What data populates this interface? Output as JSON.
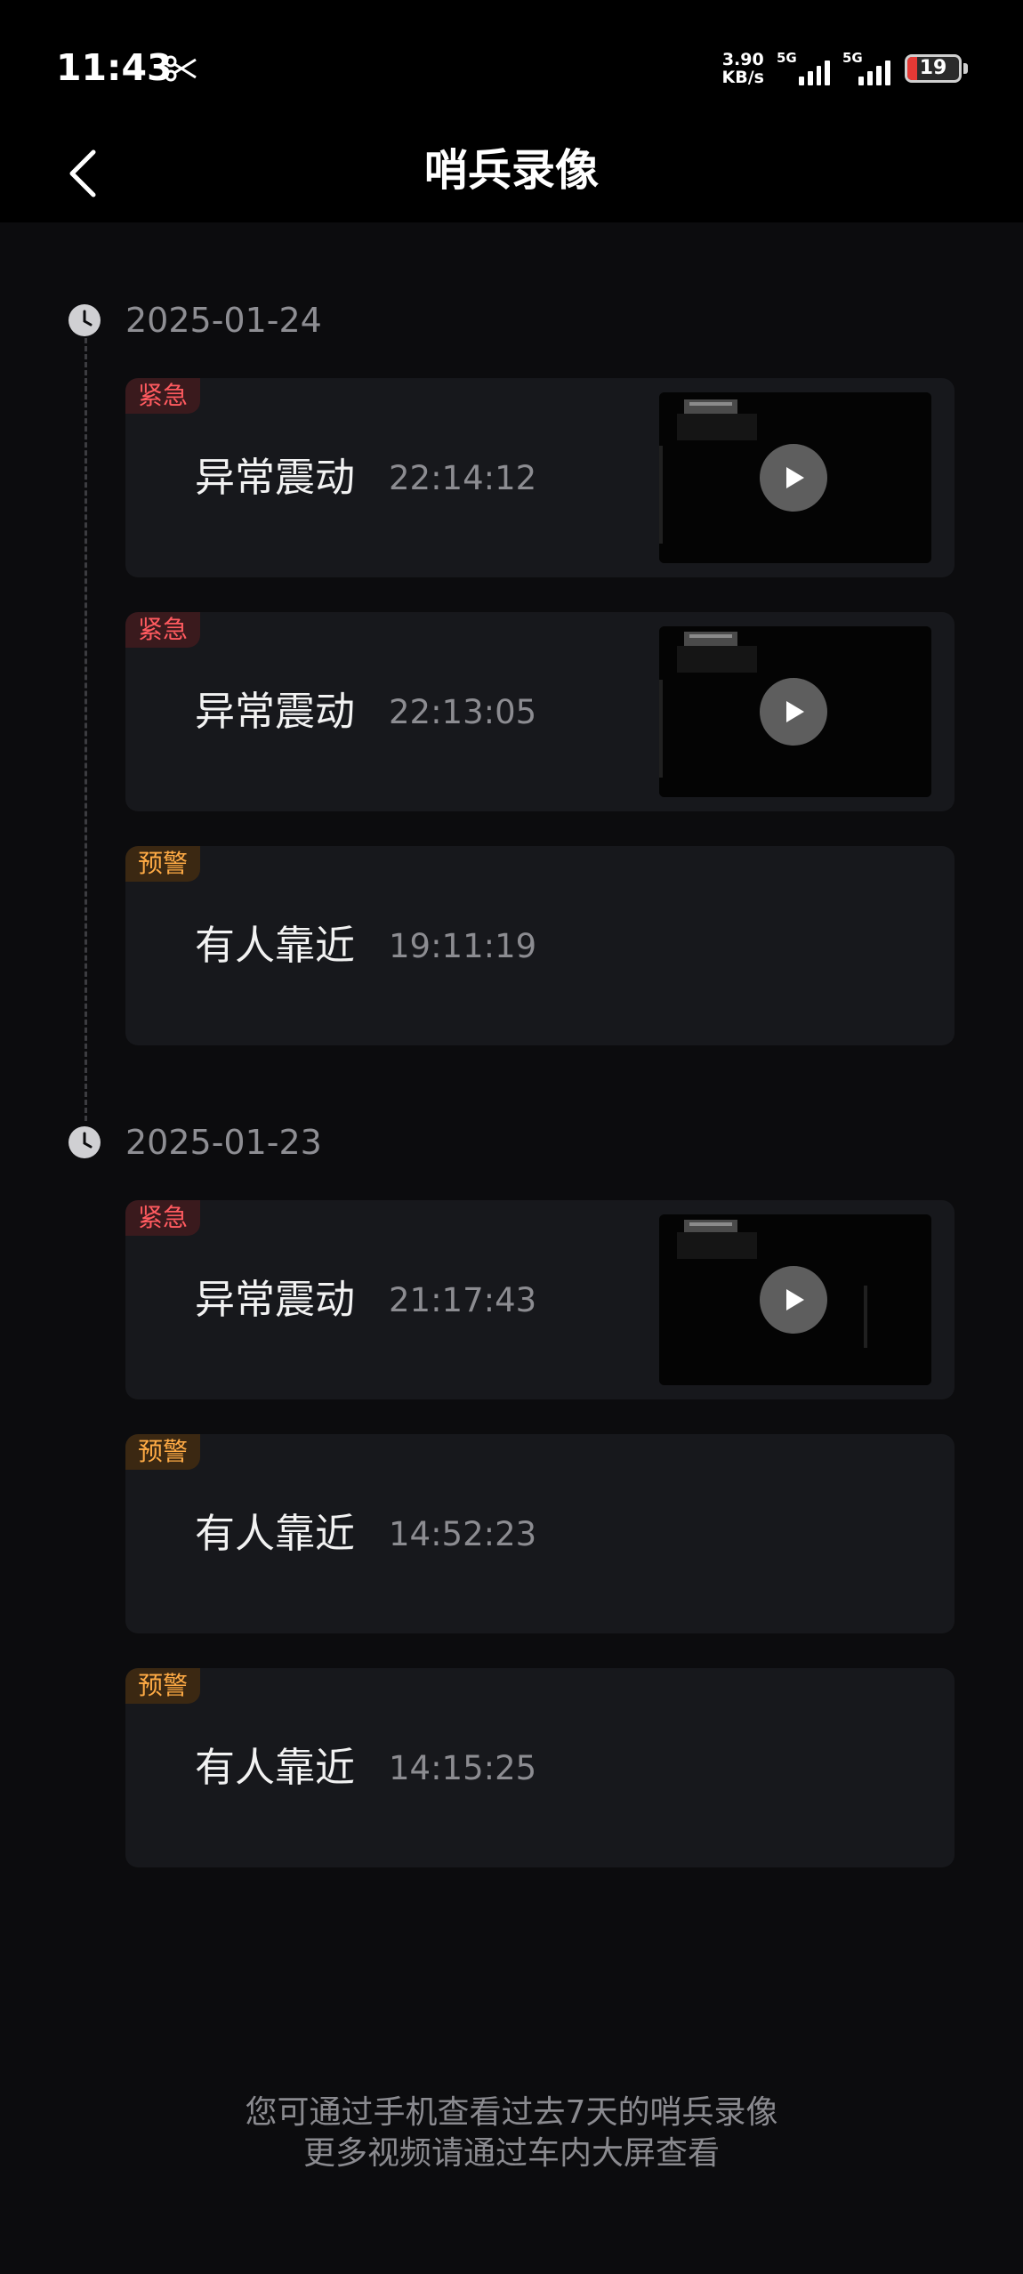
{
  "status_bar": {
    "time": "11:43",
    "net_speed_value": "3.90",
    "net_speed_unit": "KB/s",
    "signal1_label": "5G",
    "signal2_label": "5G",
    "battery_level": "19",
    "battery_color": "#e53935"
  },
  "header": {
    "title": "哨兵录像",
    "back_icon": "chevron-left-icon"
  },
  "groups": [
    {
      "date": "2025-01-24",
      "events": [
        {
          "tag": "紧急",
          "tag_type": "urgent",
          "name": "异常震动",
          "time": "22:14:12",
          "has_video": true
        },
        {
          "tag": "紧急",
          "tag_type": "urgent",
          "name": "异常震动",
          "time": "22:13:05",
          "has_video": true
        },
        {
          "tag": "预警",
          "tag_type": "warn",
          "name": "有人靠近",
          "time": "19:11:19",
          "has_video": false
        }
      ]
    },
    {
      "date": "2025-01-23",
      "events": [
        {
          "tag": "紧急",
          "tag_type": "urgent",
          "name": "异常震动",
          "time": "21:17:43",
          "has_video": true
        },
        {
          "tag": "预警",
          "tag_type": "warn",
          "name": "有人靠近",
          "time": "14:52:23",
          "has_video": false
        },
        {
          "tag": "预警",
          "tag_type": "warn",
          "name": "有人靠近",
          "time": "14:15:25",
          "has_video": false
        }
      ]
    }
  ],
  "footer": {
    "line1": "您可通过手机查看过去7天的哨兵录像",
    "line2": "更多视频请通过车内大屏查看"
  },
  "colors": {
    "urgent": "#ff5a5f",
    "warn": "#ffab45",
    "card_bg": "#17181c"
  }
}
